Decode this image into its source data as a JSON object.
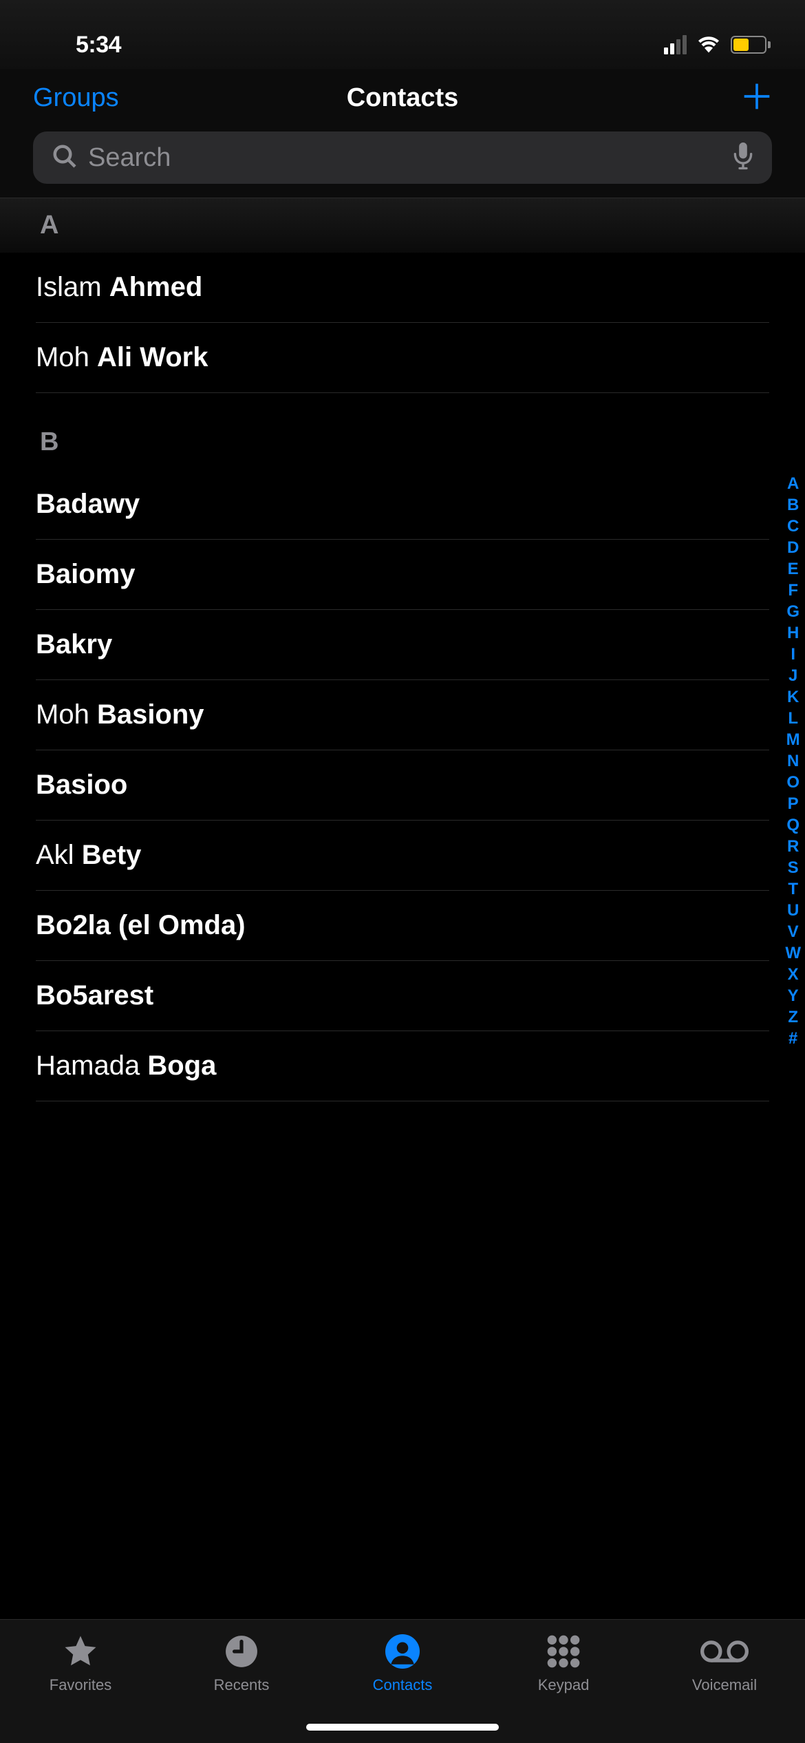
{
  "status_bar": {
    "time": "5:34"
  },
  "nav": {
    "left": "Groups",
    "title": "Contacts"
  },
  "search": {
    "placeholder": "Search"
  },
  "sections": [
    {
      "letter": "A",
      "style": "header",
      "contacts": [
        {
          "first": "Islam",
          "last": "Ahmed"
        },
        {
          "first": "Moh",
          "last": "Ali Work"
        }
      ]
    },
    {
      "letter": "B",
      "style": "plain",
      "contacts": [
        {
          "first": "",
          "last": "Badawy"
        },
        {
          "first": "",
          "last": "Baiomy"
        },
        {
          "first": "",
          "last": "Bakry"
        },
        {
          "first": "Moh",
          "last": "Basiony"
        },
        {
          "first": "",
          "last": "Basioo"
        },
        {
          "first": "Akl",
          "last": "Bety"
        },
        {
          "first": "",
          "last": "Bo2la (el Omda)"
        },
        {
          "first": "",
          "last": "Bo5arest"
        },
        {
          "first": "Hamada",
          "last": "Boga"
        }
      ]
    }
  ],
  "index_letters": [
    "A",
    "B",
    "C",
    "D",
    "E",
    "F",
    "G",
    "H",
    "I",
    "J",
    "K",
    "L",
    "M",
    "N",
    "O",
    "P",
    "Q",
    "R",
    "S",
    "T",
    "U",
    "V",
    "W",
    "X",
    "Y",
    "Z",
    "#"
  ],
  "tabs": [
    {
      "id": "favorites",
      "label": "Favorites",
      "active": false
    },
    {
      "id": "recents",
      "label": "Recents",
      "active": false
    },
    {
      "id": "contacts",
      "label": "Contacts",
      "active": true
    },
    {
      "id": "keypad",
      "label": "Keypad",
      "active": false
    },
    {
      "id": "voicemail",
      "label": "Voicemail",
      "active": false
    }
  ]
}
